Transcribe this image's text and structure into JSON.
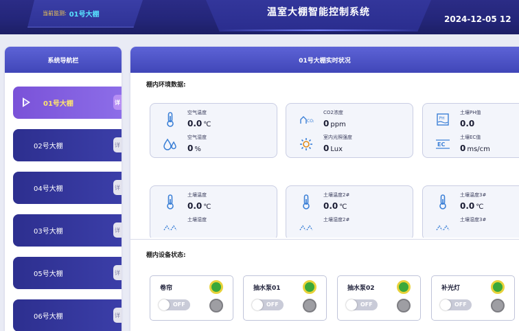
{
  "colors": {
    "header_bg": "#24267a",
    "nav_item": "#2d2f8f",
    "nav_active": "#8c6de8",
    "panel_header": "#4f55c8",
    "led_on": "#3aa83a",
    "led_off": "#9e9ea3"
  },
  "header": {
    "monitor_label": "当前监测:",
    "monitor_value": "01号大棚",
    "title": "温室大棚智能控制系统",
    "datetime": "2024-12-05 12"
  },
  "sidebar": {
    "title": "系统导航栏",
    "items": [
      {
        "label": "01号大棚",
        "active": true
      },
      {
        "label": "02号大棚",
        "active": false
      },
      {
        "label": "04号大棚",
        "active": false
      },
      {
        "label": "03号大棚",
        "active": false
      },
      {
        "label": "05号大棚",
        "active": false
      },
      {
        "label": "06号大棚",
        "active": false
      }
    ]
  },
  "main": {
    "title": "01号大棚实时状况",
    "env_section_title": "棚内环境数据:",
    "device_section_title": "棚内设备状态:",
    "cards": [
      [
        {
          "icon": "thermometer-icon",
          "label": "空气温度",
          "value": "0.0",
          "unit": "℃"
        },
        {
          "icon": "humidity-drops-icon",
          "label": "空气湿度",
          "value": "0",
          "unit": "%"
        }
      ],
      [
        {
          "icon": "co2-icon",
          "label": "CO2浓度",
          "value": "0",
          "unit": "ppm"
        },
        {
          "icon": "sun-icon",
          "label": "室内光照强度",
          "value": "0",
          "unit": "Lux"
        }
      ],
      [
        {
          "icon": "ph-icon",
          "label": "土壤PH值",
          "value": "0.0",
          "unit": ""
        },
        {
          "icon": "ec-icon",
          "label": "土壤EC值",
          "value": "0",
          "unit": "ms/cm"
        }
      ],
      [
        {
          "icon": "soil-thermometer-icon",
          "label": "土壤温度",
          "value": "0.0",
          "unit": "℃"
        },
        {
          "icon": "soil-humidity-icon",
          "label": "土壤湿度",
          "value": "",
          "unit": ""
        }
      ],
      [
        {
          "icon": "soil-thermometer-icon",
          "label": "土壤温度2#",
          "value": "0.0",
          "unit": "℃"
        },
        {
          "icon": "soil-humidity-icon",
          "label": "土壤湿度2#",
          "value": "",
          "unit": ""
        }
      ],
      [
        {
          "icon": "soil-thermometer-icon",
          "label": "土壤温度3#",
          "value": "0.0",
          "unit": "℃"
        },
        {
          "icon": "soil-humidity-icon",
          "label": "土壤湿度3#",
          "value": "",
          "unit": ""
        }
      ]
    ],
    "devices": [
      {
        "name": "卷帘",
        "toggle": "OFF"
      },
      {
        "name": "抽水泵01",
        "toggle": "OFF"
      },
      {
        "name": "抽水泵02",
        "toggle": "OFF"
      },
      {
        "name": "补光灯",
        "toggle": "OFF"
      }
    ]
  }
}
